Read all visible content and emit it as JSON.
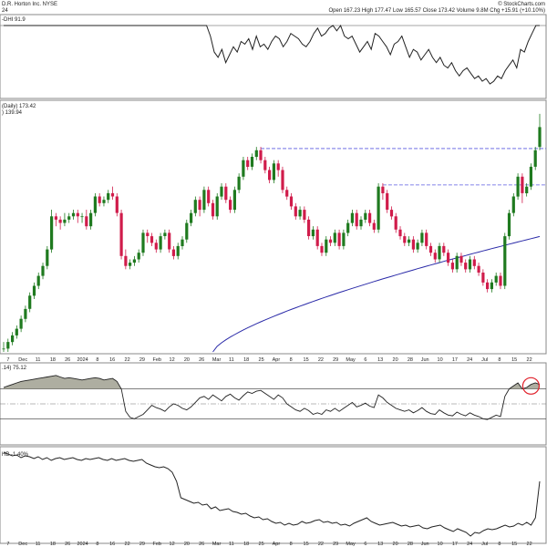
{
  "header": {
    "title": "D.R. Horton Inc.  NYSE",
    "subtitle": "24",
    "copyright": "© StockCharts.com",
    "ohlc_text": "Open 167.23  High 177.47  Low 165.57  Close 173.42  Volume 9.8M  Chg +15.91 (+10.10%)"
  },
  "panels": {
    "top_label": "-DHI 91.9",
    "price_label": "(Daily) 173.42",
    "price_label2": ") 139.94",
    "rsi_label": ".14) 75.12",
    "bottom_label": "HB -1.40%"
  },
  "colors": {
    "up": "#1f7a1f",
    "down": "#d01c4b",
    "ma": "#2a2aa8",
    "line": "#222222",
    "dashed": "#5a5ae0",
    "circle": "#e0202a"
  },
  "chart_data": [
    {
      "type": "line",
      "panel": "top",
      "title": "-DHI 91.9",
      "values": [
        100,
        100,
        100,
        100,
        100,
        100,
        100,
        100,
        100,
        100,
        100,
        100,
        100,
        100,
        100,
        100,
        100,
        100,
        100,
        100,
        100,
        100,
        100,
        100,
        100,
        100,
        100,
        100,
        100,
        100,
        100,
        100,
        100,
        100,
        100,
        100,
        100,
        100,
        100,
        100,
        100,
        100,
        100,
        100,
        100,
        100,
        100,
        100,
        100,
        100,
        100,
        100,
        100,
        100,
        96,
        90,
        88,
        91,
        86,
        89,
        92,
        90,
        94,
        93,
        95,
        91,
        96,
        92,
        93,
        91,
        94,
        96,
        95,
        92,
        94,
        97,
        96,
        95,
        93,
        92,
        94,
        97,
        99,
        96,
        97,
        99,
        100,
        98,
        100,
        96,
        95,
        96,
        93,
        90,
        92,
        94,
        91,
        97,
        96,
        94,
        92,
        89,
        93,
        94,
        96,
        92,
        88,
        91,
        90,
        87,
        89,
        91,
        88,
        86,
        88,
        85,
        84,
        86,
        83,
        81,
        83,
        84,
        82,
        80,
        81,
        79,
        80,
        78,
        79,
        81,
        80,
        83,
        85,
        87,
        84,
        91,
        90,
        94,
        97,
        100,
        100
      ],
      "last_value": 91.9
    },
    {
      "type": "candlestick",
      "panel": "price",
      "title": "(Daily) 173.42",
      "ylim": [
        105,
        180
      ],
      "candles": [
        [
          106,
          106,
          108,
          105
        ],
        [
          106,
          108,
          109,
          105
        ],
        [
          108,
          110,
          111,
          107
        ],
        [
          110,
          112,
          113,
          109
        ],
        [
          112,
          115,
          116,
          111
        ],
        [
          115,
          118,
          119,
          114
        ],
        [
          118,
          122,
          123,
          117
        ],
        [
          122,
          125,
          126,
          121
        ],
        [
          125,
          128,
          129,
          124
        ],
        [
          128,
          131,
          132,
          127
        ],
        [
          131,
          136,
          137,
          130
        ],
        [
          136,
          146,
          148,
          135
        ],
        [
          146,
          145,
          147,
          143
        ],
        [
          145,
          144,
          146,
          142
        ],
        [
          144,
          145,
          147,
          143
        ],
        [
          145,
          146,
          147,
          144
        ],
        [
          146,
          147,
          148,
          145
        ],
        [
          147,
          146,
          148,
          144
        ],
        [
          146,
          146,
          147,
          144
        ],
        [
          146,
          143,
          148,
          142
        ],
        [
          143,
          147,
          148,
          142
        ],
        [
          147,
          152,
          153,
          146
        ],
        [
          152,
          150,
          153,
          149
        ],
        [
          150,
          151,
          152,
          149
        ],
        [
          151,
          153,
          154,
          150
        ],
        [
          153,
          152,
          155,
          151
        ],
        [
          152,
          147,
          153,
          146
        ],
        [
          147,
          134,
          148,
          133
        ],
        [
          134,
          131,
          136,
          130
        ],
        [
          131,
          132,
          133,
          130
        ],
        [
          132,
          133,
          134,
          131
        ],
        [
          133,
          135,
          136,
          132
        ],
        [
          135,
          141,
          142,
          134
        ],
        [
          141,
          140,
          142,
          138
        ],
        [
          140,
          138,
          141,
          137
        ],
        [
          138,
          136,
          139,
          135
        ],
        [
          136,
          140,
          141,
          135
        ],
        [
          140,
          141,
          142,
          139
        ],
        [
          141,
          136,
          142,
          135
        ],
        [
          136,
          134,
          137,
          133
        ],
        [
          134,
          137,
          138,
          133
        ],
        [
          137,
          139,
          140,
          136
        ],
        [
          139,
          144,
          145,
          138
        ],
        [
          144,
          147,
          148,
          143
        ],
        [
          147,
          151,
          152,
          146
        ],
        [
          151,
          148,
          152,
          146
        ],
        [
          148,
          154,
          155,
          147
        ],
        [
          154,
          150,
          155,
          149
        ],
        [
          150,
          146,
          151,
          145
        ],
        [
          146,
          152,
          153,
          145
        ],
        [
          152,
          155,
          156,
          151
        ],
        [
          155,
          151,
          156,
          150
        ],
        [
          151,
          148,
          152,
          147
        ],
        [
          148,
          154,
          155,
          147
        ],
        [
          154,
          158,
          159,
          153
        ],
        [
          158,
          163,
          164,
          157
        ],
        [
          163,
          161,
          164,
          160
        ],
        [
          161,
          164,
          165,
          160
        ],
        [
          164,
          166,
          167,
          163
        ],
        [
          166,
          163,
          167,
          162
        ],
        [
          163,
          160,
          164,
          159
        ],
        [
          160,
          157,
          161,
          156
        ],
        [
          157,
          162,
          163,
          156
        ],
        [
          162,
          160,
          163,
          158
        ],
        [
          160,
          154,
          161,
          153
        ],
        [
          154,
          152,
          155,
          151
        ],
        [
          152,
          149,
          153,
          148
        ],
        [
          149,
          146,
          150,
          145
        ],
        [
          146,
          148,
          149,
          145
        ],
        [
          148,
          145,
          149,
          144
        ],
        [
          145,
          140,
          146,
          139
        ],
        [
          140,
          142,
          143,
          139
        ],
        [
          142,
          137,
          143,
          136
        ],
        [
          137,
          135,
          138,
          134
        ],
        [
          135,
          139,
          140,
          134
        ],
        [
          139,
          138,
          140,
          137
        ],
        [
          138,
          141,
          142,
          137
        ],
        [
          141,
          137,
          142,
          136
        ],
        [
          137,
          141,
          142,
          136
        ],
        [
          141,
          144,
          145,
          140
        ],
        [
          144,
          147,
          148,
          143
        ],
        [
          147,
          143,
          148,
          142
        ],
        [
          143,
          145,
          146,
          142
        ],
        [
          145,
          147,
          148,
          144
        ],
        [
          147,
          144,
          148,
          143
        ],
        [
          144,
          142,
          145,
          141
        ],
        [
          142,
          155,
          156,
          141
        ],
        [
          155,
          153,
          156,
          151
        ],
        [
          153,
          148,
          154,
          147
        ],
        [
          148,
          146,
          149,
          145
        ],
        [
          146,
          142,
          147,
          141
        ],
        [
          142,
          140,
          143,
          139
        ],
        [
          140,
          138,
          141,
          137
        ],
        [
          138,
          139,
          140,
          137
        ],
        [
          139,
          136,
          140,
          135
        ],
        [
          136,
          138,
          139,
          135
        ],
        [
          138,
          141,
          142,
          137
        ],
        [
          141,
          137,
          142,
          136
        ],
        [
          137,
          135,
          138,
          134
        ],
        [
          135,
          133,
          136,
          132
        ],
        [
          133,
          137,
          138,
          132
        ],
        [
          137,
          135,
          138,
          134
        ],
        [
          135,
          132,
          136,
          131
        ],
        [
          132,
          130,
          133,
          129
        ],
        [
          130,
          134,
          135,
          129
        ],
        [
          134,
          132,
          135,
          131
        ],
        [
          132,
          130,
          133,
          129
        ],
        [
          130,
          133,
          134,
          129
        ],
        [
          133,
          131,
          134,
          130
        ],
        [
          131,
          129,
          132,
          128
        ],
        [
          129,
          126,
          130,
          125
        ],
        [
          126,
          124,
          127,
          123
        ],
        [
          124,
          126,
          127,
          123
        ],
        [
          126,
          128,
          129,
          125
        ],
        [
          128,
          125,
          129,
          124
        ],
        [
          125,
          140,
          141,
          124
        ],
        [
          140,
          147,
          148,
          139
        ],
        [
          147,
          152,
          153,
          146
        ],
        [
          152,
          158,
          159,
          151
        ],
        [
          158,
          153,
          159,
          150
        ],
        [
          153,
          155,
          156,
          152
        ],
        [
          155,
          161,
          162,
          154
        ],
        [
          161,
          166,
          167,
          160
        ],
        [
          167,
          173,
          177,
          166
        ]
      ],
      "ma_label": ") 139.94",
      "ma": {
        "start_index": 48,
        "from": 105,
        "to": 139.9
      },
      "resistance_levels": [
        {
          "value": 166.5,
          "from_index": 59
        },
        {
          "value": 155.5,
          "from_index": 87
        }
      ],
      "x_ticks": [
        "7",
        "Dec",
        "11",
        "18",
        "26",
        "2024",
        "8",
        "16",
        "22",
        "29",
        "Feb",
        "12",
        "20",
        "26",
        "Mar",
        "11",
        "18",
        "25",
        "Apr",
        "8",
        "15",
        "22",
        "29",
        "May",
        "6",
        "13",
        "20",
        "28",
        "Jun",
        "10",
        "17",
        "24",
        "Jul",
        "8",
        "15",
        "22"
      ]
    },
    {
      "type": "line",
      "panel": "rsi",
      "title": ".14) 75.12",
      "ylim": [
        0,
        100
      ],
      "levels": [
        70,
        30
      ],
      "values": [
        72,
        74,
        76,
        78,
        80,
        81,
        82,
        83,
        84,
        85,
        86,
        87,
        88,
        86,
        84,
        85,
        84,
        83,
        82,
        83,
        84,
        85,
        84,
        82,
        83,
        84,
        80,
        70,
        40,
        32,
        30,
        33,
        36,
        42,
        48,
        45,
        43,
        40,
        46,
        50,
        48,
        44,
        42,
        46,
        52,
        58,
        60,
        56,
        62,
        58,
        54,
        60,
        63,
        58,
        55,
        61,
        66,
        64,
        67,
        68,
        64,
        60,
        56,
        62,
        58,
        50,
        46,
        42,
        40,
        44,
        41,
        36,
        38,
        36,
        42,
        40,
        44,
        40,
        44,
        48,
        52,
        46,
        48,
        51,
        47,
        45,
        62,
        58,
        52,
        48,
        44,
        42,
        40,
        42,
        38,
        41,
        45,
        40,
        37,
        36,
        42,
        38,
        35,
        34,
        39,
        36,
        34,
        38,
        35,
        33,
        30,
        29,
        32,
        35,
        33,
        60,
        70,
        74,
        78,
        70,
        72,
        76,
        78,
        76
      ],
      "last_value": 75.12
    },
    {
      "type": "line",
      "panel": "bottom",
      "title": "HB -1.40%",
      "values": [
        -8,
        -10,
        -12,
        -11,
        -14,
        -12,
        -13,
        -15,
        -13,
        -16,
        -14,
        -17,
        -15,
        -14,
        -16,
        -15,
        -14,
        -16,
        -17,
        -15,
        -16,
        -15,
        -14,
        -16,
        -17,
        -15,
        -17,
        -16,
        -15,
        -17,
        -18,
        -17,
        -16,
        -20,
        -22,
        -24,
        -25,
        -24,
        -26,
        -30,
        -40,
        -58,
        -60,
        -62,
        -64,
        -63,
        -66,
        -65,
        -70,
        -68,
        -72,
        -71,
        -70,
        -73,
        -74,
        -76,
        -75,
        -78,
        -80,
        -79,
        -82,
        -81,
        -84,
        -86,
        -85,
        -88,
        -86,
        -88,
        -87,
        -84,
        -86,
        -85,
        -83,
        -82,
        -85,
        -84,
        -86,
        -85,
        -88,
        -87,
        -89,
        -86,
        -84,
        -82,
        -80,
        -84,
        -86,
        -88,
        -87,
        -86,
        -85,
        -87,
        -89,
        -88,
        -90,
        -89,
        -88,
        -91,
        -92,
        -90,
        -89,
        -88,
        -91,
        -93,
        -95,
        -92,
        -94,
        -96,
        -100,
        -96,
        -97,
        -94,
        -92,
        -93,
        -92,
        -90,
        -88,
        -90,
        -89,
        -86,
        -88,
        -85,
        -88,
        -80,
        -40
      ],
      "last_value": -1.4
    }
  ]
}
